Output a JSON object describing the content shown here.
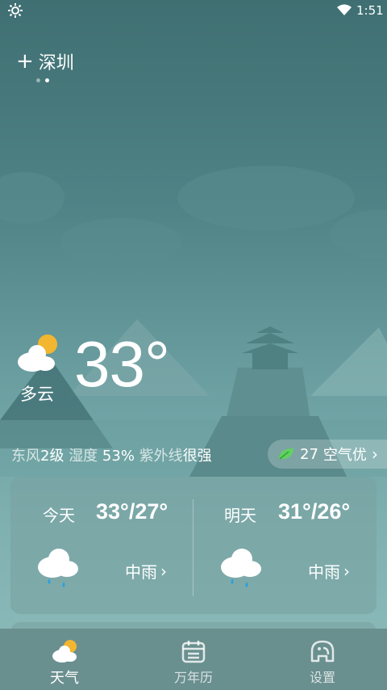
{
  "status_bar": {
    "time": "1:51"
  },
  "location": {
    "add_label": "+",
    "city": "深圳"
  },
  "current": {
    "temperature": "33°",
    "condition": "多云"
  },
  "details": {
    "wind_label": "东风",
    "wind_value": "2级",
    "humidity_label": "湿度",
    "humidity_value": "53%",
    "uv_label": "紫外线",
    "uv_value": "很强"
  },
  "aqi": {
    "value": "27",
    "label": "空气优"
  },
  "forecast": [
    {
      "day": "今天",
      "temps": "33°/27°",
      "condition": "中雨"
    },
    {
      "day": "明天",
      "temps": "31°/26°",
      "condition": "中雨"
    }
  ],
  "nav": [
    {
      "label": "天气",
      "icon": "partly-cloudy-icon",
      "active": true
    },
    {
      "label": "万年历",
      "icon": "calendar-icon",
      "active": false
    },
    {
      "label": "设置",
      "icon": "elephant-icon",
      "active": false
    }
  ],
  "colors": {
    "card": "#78a0a0",
    "nav": "#6a8f8f",
    "leaf": "#5fd35f",
    "sun": "#f2b630"
  }
}
